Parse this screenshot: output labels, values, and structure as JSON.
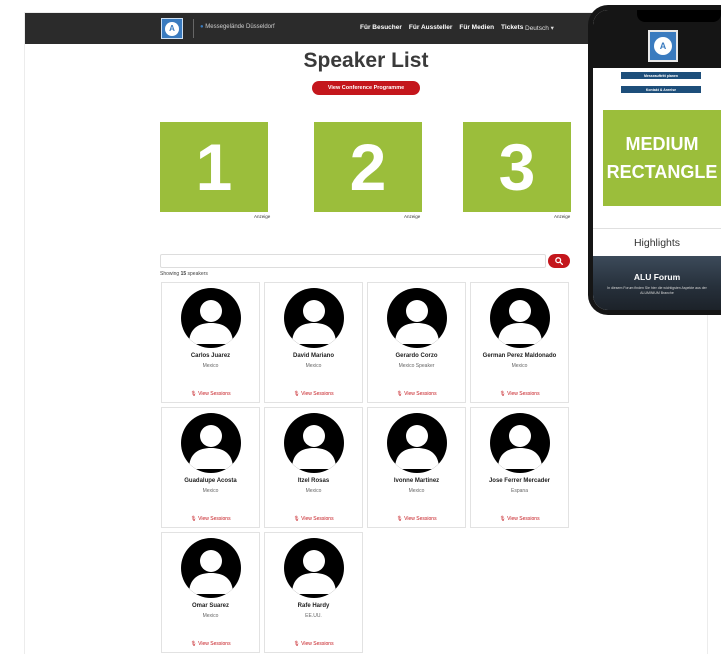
{
  "nav": {
    "tagline": "Messegelände Düsseldorf",
    "links": [
      "Für Besucher",
      "Für Aussteller",
      "Für Medien",
      "Tickets"
    ],
    "language": "Deutsch"
  },
  "page": {
    "title": "Speaker List",
    "cta_label": "View Conference Programme"
  },
  "ads": [
    {
      "number": "1",
      "label": "Anzeige"
    },
    {
      "number": "2",
      "label": "Anzeige"
    },
    {
      "number": "3",
      "label": "Anzeige"
    }
  ],
  "search": {
    "placeholder": "",
    "showing_prefix": "Showing",
    "count": "15",
    "showing_suffix": "speakers"
  },
  "speakers": [
    {
      "name": "Carlos Juarez",
      "subtitle": "Mexico",
      "link": "View Sessions"
    },
    {
      "name": "David Mariano",
      "subtitle": "Mexico",
      "link": "View Sessions"
    },
    {
      "name": "Gerardo Corzo",
      "subtitle": "Mexico Speaker",
      "link": "View Sessions"
    },
    {
      "name": "German Perez Maldonado",
      "subtitle": "Mexico",
      "link": "View Sessions"
    },
    {
      "name": "Guadalupe Acosta",
      "subtitle": "Mexico",
      "link": "View Sessions"
    },
    {
      "name": "Itzel Rosas",
      "subtitle": "Mexico",
      "link": "View Sessions"
    },
    {
      "name": "Ivonne Martinez",
      "subtitle": "Mexico",
      "link": "View Sessions"
    },
    {
      "name": "Jose Ferrer Mercader",
      "subtitle": "Espana",
      "link": "View Sessions"
    },
    {
      "name": "Omar Suarez",
      "subtitle": "Mexico",
      "link": "View Sessions"
    },
    {
      "name": "Rafe Hardy",
      "subtitle": "EE.UU.",
      "link": "View Sessions"
    }
  ],
  "phone": {
    "menu_buttons": [
      "Messeauftritt planen",
      "Kontakt & Anreise"
    ],
    "ad_line1": "MEDIUM",
    "ad_line2": "RECTANGLE",
    "highlights": "Highlights",
    "banner_title": "ALU Forum",
    "banner_text": "In diesem Forum finden Sie hier die wichtigsten Aspekte aus der ALUMINIUM Branche"
  },
  "colors": {
    "nav_bg": "#2b2b2b",
    "accent_red": "#c4161c",
    "ad_green": "#9bbe3b",
    "brand_blue": "#3a7bbf"
  },
  "icons": [
    "logo-icon",
    "search-icon",
    "avatar-placeholder-icon",
    "microphone-icon"
  ]
}
